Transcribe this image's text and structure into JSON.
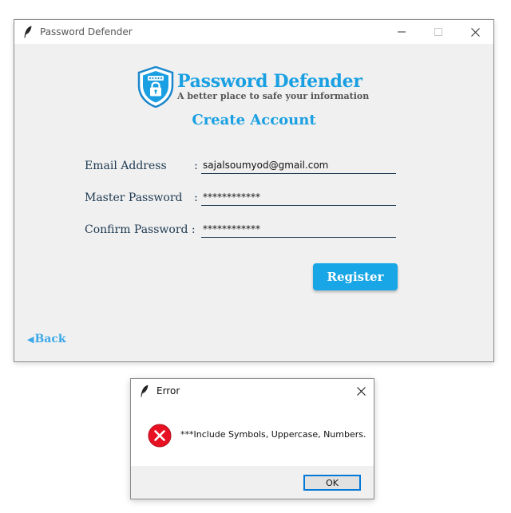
{
  "main_window": {
    "title": "Password Defender",
    "brand": {
      "name": "Password Defender",
      "tagline": "A better place to safe your information",
      "logo_icon": "shield-lock-icon"
    },
    "heading": "Create Account",
    "form": {
      "email": {
        "label": "Email Address",
        "colon": ":",
        "value": "sajalsoumyod@gmail.com"
      },
      "master_password": {
        "label": "Master Password",
        "colon": ":",
        "value": "************"
      },
      "confirm_password": {
        "label": "Confirm Password :",
        "colon": "",
        "value": "************"
      }
    },
    "register_label": "Register",
    "back_label": "Back",
    "colors": {
      "accent": "#1aa0e2",
      "label": "#1e3a52",
      "background": "#f0f0f0"
    }
  },
  "error_dialog": {
    "title": "Error",
    "message": "***Include Symbols, Uppercase, Numbers.",
    "ok_label": "OK",
    "icon": "error-x-icon",
    "colors": {
      "error": "#e81123"
    }
  }
}
